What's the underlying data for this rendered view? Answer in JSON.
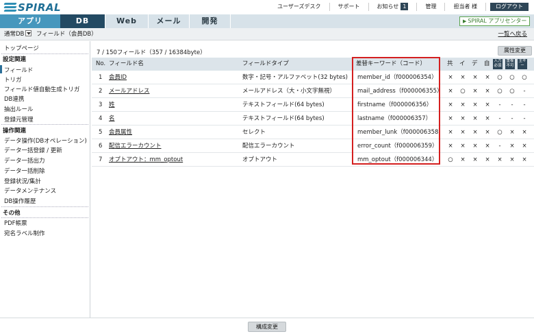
{
  "logo": "SPIRAL",
  "topnav": {
    "user_desk": "ユーザーズデスク",
    "support": "サポート",
    "notice": "お知らせ",
    "notice_count": "1",
    "admin": "管理",
    "user": "担当者 様",
    "logout": "ログアウト"
  },
  "tabs": {
    "app": "アプリ",
    "db": "DB",
    "web": "Web",
    "mail": "メール",
    "dev": "開発",
    "app_center": "SPIRAL アプリセンター"
  },
  "breadcrumb": {
    "db_type": "通常DB",
    "current": "フィールド（会員DB）",
    "back": "一覧へ戻る"
  },
  "sidebar": {
    "top": "トップページ",
    "settings_head": "設定関連",
    "settings": [
      "フィールド",
      "トリガ",
      "フィールド値自動生成トリガ",
      "DB連携",
      "抽出ルール",
      "登録元管理"
    ],
    "ops_head": "操作関連",
    "ops": [
      "データ操作(DBオペレーション)",
      "データ一括登録 / 更新",
      "データ一括出力",
      "データ一括削除",
      "登録状況/集計",
      "データメンテナンス",
      "DB操作履歴"
    ],
    "other_head": "その他",
    "other": [
      "PDF帳票",
      "宛名ラベル制作"
    ]
  },
  "main": {
    "count": "7 / 150フィールド（357 / 16384byte）",
    "attr_button": "属性変更",
    "headers": {
      "no": "No.",
      "name": "フィールド名",
      "type": "フィールドタイプ",
      "keyword": "差替キーワード（コード）",
      "c1": "共",
      "c2": "イ",
      "c3": "デ",
      "c4": "自",
      "c5": "入力必須",
      "c6": "重複不可",
      "c7": "主キー"
    },
    "rows": [
      {
        "no": "1",
        "name": "会員ID",
        "type": "数字・記号・アルファベット(32 bytes)",
        "keyword": "member_id（f000006354）",
        "marks": [
          "×",
          "×",
          "×",
          "×",
          "○",
          "○",
          "○"
        ]
      },
      {
        "no": "2",
        "name": "メールアドレス",
        "type": "メールアドレス（大・小文字無視）",
        "keyword": "mail_address（f000006355）",
        "marks": [
          "×",
          "○",
          "×",
          "×",
          "○",
          "○",
          "-"
        ]
      },
      {
        "no": "3",
        "name": "姓",
        "type": "テキストフィールド(64 bytes)",
        "keyword": "firstname（f000006356）",
        "marks": [
          "×",
          "×",
          "×",
          "×",
          "-",
          "-",
          "-"
        ]
      },
      {
        "no": "4",
        "name": "名",
        "type": "テキストフィールド(64 bytes)",
        "keyword": "lastname（f000006357）",
        "marks": [
          "×",
          "×",
          "×",
          "×",
          "-",
          "-",
          "-"
        ]
      },
      {
        "no": "5",
        "name": "会員属性",
        "type": "セレクト",
        "keyword": "member_lunk（f000006358）",
        "marks": [
          "×",
          "×",
          "×",
          "×",
          "○",
          "×",
          "×"
        ]
      },
      {
        "no": "6",
        "name": "配信エラーカウント",
        "type": "配信エラーカウント",
        "keyword": "error_count（f000006359）",
        "marks": [
          "×",
          "×",
          "×",
          "×",
          "-",
          "×",
          "×"
        ]
      },
      {
        "no": "7",
        "name": "オプトアウト：mm_optout",
        "type": "オプトアウト",
        "keyword": "mm_optout（f000006344）",
        "marks": [
          "○",
          "×",
          "×",
          "×",
          "×",
          "×",
          "×"
        ]
      }
    ]
  },
  "footer": {
    "save_button": "構成変更"
  },
  "colors": {
    "highlight": "#d41f1f",
    "db_tab": "#234a63",
    "app_tab": "#4797bd"
  }
}
